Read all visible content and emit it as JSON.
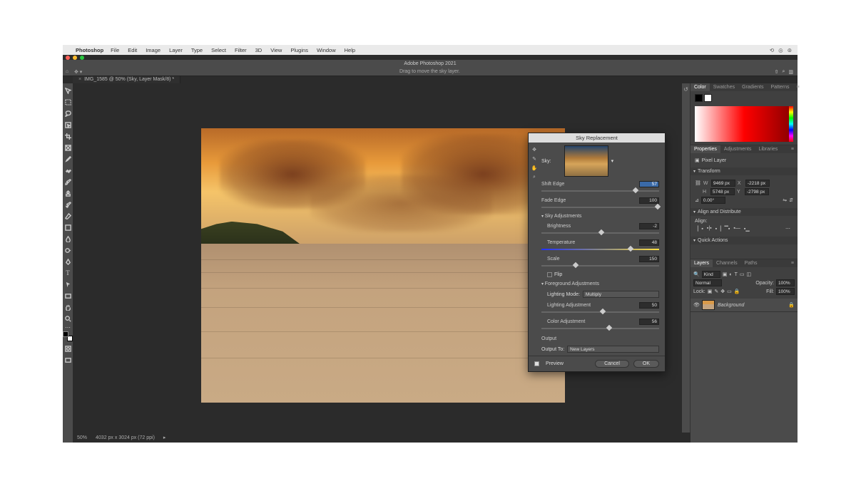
{
  "mac_menu": {
    "app": "Photoshop",
    "items": [
      "File",
      "Edit",
      "Image",
      "Layer",
      "Type",
      "Select",
      "Filter",
      "3D",
      "View",
      "Plugins",
      "Window",
      "Help"
    ]
  },
  "window_title": "Adobe Photoshop 2021",
  "options_hint": "Drag to move the sky layer.",
  "doc_tab": "IMG_1585 @ 50% (Sky, Layer Mask/8) *",
  "status": {
    "zoom": "50%",
    "doc": "4032 px x 3024 px (72 ppi)"
  },
  "color_panel": {
    "tabs": [
      "Color",
      "Swatches",
      "Gradients",
      "Patterns"
    ]
  },
  "properties": {
    "tabs": [
      "Properties",
      "Adjustments",
      "Libraries"
    ],
    "kind": "Pixel Layer",
    "transform_hd": "Transform",
    "W": "9469 px",
    "X": "-2218 px",
    "H": "5748 px",
    "Y": "-2798 px",
    "angle": "0.00°",
    "align_hd": "Align and Distribute",
    "align_lbl": "Align:",
    "quick_hd": "Quick Actions"
  },
  "layers_panel": {
    "tabs": [
      "Layers",
      "Channels",
      "Paths"
    ],
    "search_ph": "Kind",
    "blend": "Normal",
    "opacity_lbl": "Opacity:",
    "opacity": "100%",
    "lock_lbl": "Lock:",
    "fill_lbl": "Fill:",
    "fill": "100%",
    "layer_name": "Background"
  },
  "sky_dialog": {
    "title": "Sky Replacement",
    "sky_lbl": "Sky:",
    "shift_edge_lbl": "Shift Edge",
    "shift_edge": "57",
    "fade_edge_lbl": "Fade Edge",
    "fade_edge": "100",
    "sky_adj_hd": "Sky Adjustments",
    "brightness_lbl": "Brightness",
    "brightness": "-2",
    "temperature_lbl": "Temperature",
    "temperature": "48",
    "scale_lbl": "Scale",
    "scale": "150",
    "flip_lbl": "Flip",
    "fg_adj_hd": "Foreground Adjustments",
    "lighting_mode_lbl": "Lighting Mode:",
    "lighting_mode": "Multiply",
    "lighting_adj_lbl": "Lighting Adjustment",
    "lighting_adj": "50",
    "color_adj_lbl": "Color Adjustment",
    "color_adj": "56",
    "output_hd": "Output",
    "output_to_lbl": "Output To:",
    "output_to": "New Layers",
    "preview_lbl": "Preview",
    "cancel": "Cancel",
    "ok": "OK"
  }
}
